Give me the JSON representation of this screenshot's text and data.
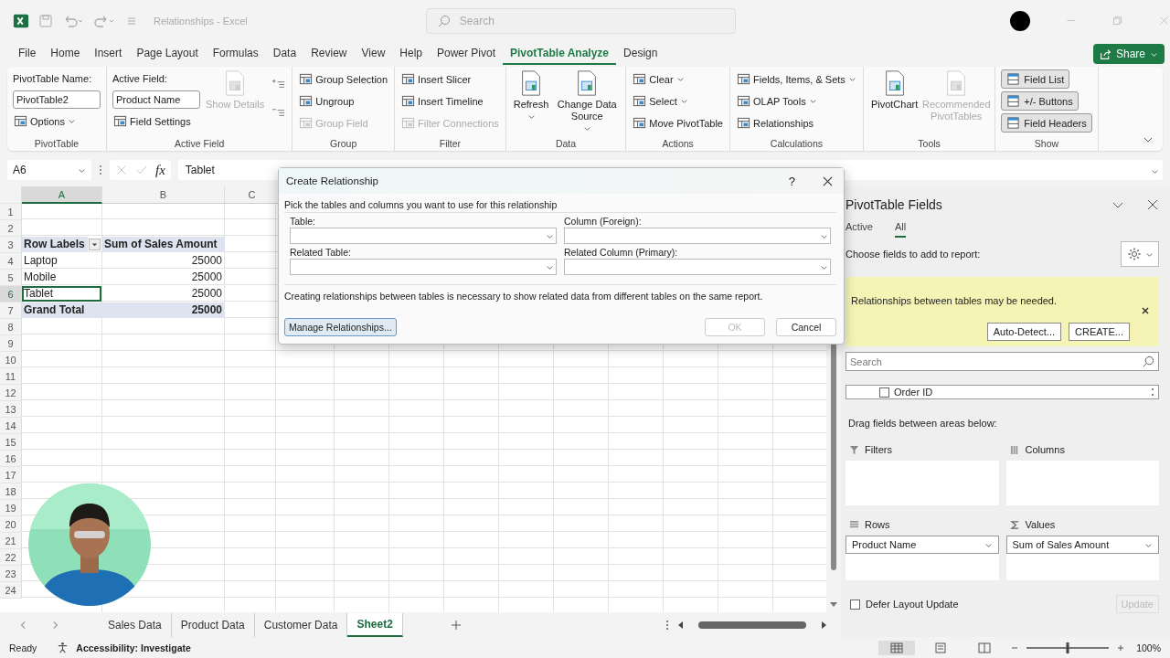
{
  "title_bar": {
    "title": "Relationships - Excel",
    "search_placeholder": "Search"
  },
  "menu_tabs": [
    {
      "label": "File",
      "selected": false
    },
    {
      "label": "Home",
      "selected": false
    },
    {
      "label": "Insert",
      "selected": false
    },
    {
      "label": "Page Layout",
      "selected": false
    },
    {
      "label": "Formulas",
      "selected": false
    },
    {
      "label": "Data",
      "selected": false
    },
    {
      "label": "Review",
      "selected": false
    },
    {
      "label": "View",
      "selected": false
    },
    {
      "label": "Help",
      "selected": false
    },
    {
      "label": "Power Pivot",
      "selected": false
    },
    {
      "label": "PivotTable Analyze",
      "selected": true
    },
    {
      "label": "Design",
      "selected": false
    }
  ],
  "share_button": "Share",
  "ribbon_groups": [
    {
      "name": "PivotTable",
      "columns": [
        [
          {
            "kind": "text",
            "text": "PivotTable Name:"
          },
          {
            "kind": "input",
            "value": "PivotTable2"
          },
          {
            "kind": "button",
            "label": "Options",
            "dropdown": true,
            "disabled": false
          }
        ]
      ]
    },
    {
      "name": "Active Field",
      "columns": [
        [
          {
            "kind": "text",
            "text": "Active Field:"
          },
          {
            "kind": "input",
            "value": "Product Name"
          },
          {
            "kind": "button",
            "label": "Field Settings",
            "dropdown": false,
            "disabled": false
          }
        ],
        [
          {
            "kind": "large",
            "label": "Show Details",
            "dropdown": false,
            "disabled": true
          }
        ],
        [
          {
            "kind": "expand_button"
          },
          {
            "kind": "collapse_button"
          }
        ]
      ]
    },
    {
      "name": "Group",
      "columns": [
        [
          {
            "kind": "button",
            "label": "Group Selection",
            "dropdown": false,
            "disabled": false
          },
          {
            "kind": "button",
            "label": "Ungroup",
            "dropdown": false,
            "disabled": false
          },
          {
            "kind": "button",
            "label": "Group Field",
            "dropdown": false,
            "disabled": true
          }
        ]
      ]
    },
    {
      "name": "Filter",
      "columns": [
        [
          {
            "kind": "button",
            "label": "Insert Slicer",
            "dropdown": false,
            "disabled": false
          },
          {
            "kind": "button",
            "label": "Insert Timeline",
            "dropdown": false,
            "disabled": false
          },
          {
            "kind": "button",
            "label": "Filter Connections",
            "dropdown": false,
            "disabled": true
          }
        ]
      ]
    },
    {
      "name": "Data",
      "columns": [
        [
          {
            "kind": "large",
            "label": "Refresh",
            "dropdown": true,
            "disabled": false
          }
        ],
        [
          {
            "kind": "large",
            "label": "Change Data Source",
            "dropdown": true,
            "disabled": false
          }
        ]
      ]
    },
    {
      "name": "Actions",
      "columns": [
        [
          {
            "kind": "button",
            "label": "Clear",
            "dropdown": true,
            "disabled": false
          },
          {
            "kind": "button",
            "label": "Select",
            "dropdown": true,
            "disabled": false
          },
          {
            "kind": "button",
            "label": "Move PivotTable",
            "dropdown": false,
            "disabled": false
          }
        ]
      ]
    },
    {
      "name": "Calculations",
      "columns": [
        [
          {
            "kind": "button",
            "label": "Fields, Items, & Sets",
            "dropdown": true,
            "disabled": false
          },
          {
            "kind": "button",
            "label": "OLAP Tools",
            "dropdown": true,
            "disabled": false
          },
          {
            "kind": "button",
            "label": "Relationships",
            "dropdown": false,
            "disabled": false
          }
        ]
      ]
    },
    {
      "name": "Tools",
      "columns": [
        [
          {
            "kind": "large",
            "label": "PivotChart",
            "dropdown": false,
            "disabled": false
          }
        ],
        [
          {
            "kind": "large",
            "label": "Recommended PivotTables",
            "dropdown": false,
            "disabled": true
          }
        ]
      ]
    },
    {
      "name": "Show",
      "columns": [
        [
          {
            "kind": "toggle",
            "label": "Field List",
            "selected": true
          },
          {
            "kind": "toggle",
            "label": "+/- Buttons",
            "selected": true
          },
          {
            "kind": "toggle",
            "label": "Field Headers",
            "selected": true
          }
        ]
      ]
    }
  ],
  "formula_bar": {
    "name_box": "A6",
    "function_label": "fx",
    "formula": "Tablet"
  },
  "sheet": {
    "columns": [
      {
        "label": "A",
        "selected": true
      },
      {
        "label": "B",
        "selected": false
      },
      {
        "label": "C",
        "selected": false
      }
    ],
    "rows": [
      {
        "number": "1",
        "kind": "empty",
        "selected": false
      },
      {
        "number": "2",
        "kind": "empty",
        "selected": false
      },
      {
        "number": "3",
        "kind": "header",
        "a": "Row Labels",
        "b": "Sum of Sales Amount",
        "selected": false
      },
      {
        "number": "4",
        "kind": "item",
        "a": "Laptop",
        "b": "25000",
        "selected": false
      },
      {
        "number": "5",
        "kind": "item",
        "a": "Mobile",
        "b": "25000",
        "selected": false
      },
      {
        "number": "6",
        "kind": "item",
        "a": "Tablet",
        "b": "25000",
        "selected": true
      },
      {
        "number": "7",
        "kind": "total",
        "a": "Grand Total",
        "b": "25000",
        "selected": false
      },
      {
        "number": "8",
        "kind": "empty",
        "selected": false
      },
      {
        "number": "9",
        "kind": "empty",
        "selected": false
      },
      {
        "number": "10",
        "kind": "empty",
        "selected": false
      },
      {
        "number": "11",
        "kind": "empty",
        "selected": false
      },
      {
        "number": "12",
        "kind": "empty",
        "selected": false
      },
      {
        "number": "13",
        "kind": "empty",
        "selected": false
      },
      {
        "number": "14",
        "kind": "empty",
        "selected": false
      },
      {
        "number": "15",
        "kind": "empty",
        "selected": false
      },
      {
        "number": "16",
        "kind": "empty",
        "selected": false
      },
      {
        "number": "17",
        "kind": "empty",
        "selected": false
      },
      {
        "number": "18",
        "kind": "empty",
        "selected": false
      },
      {
        "number": "19",
        "kind": "empty",
        "selected": false
      },
      {
        "number": "20",
        "kind": "empty",
        "selected": false
      },
      {
        "number": "21",
        "kind": "empty",
        "selected": false
      },
      {
        "number": "22",
        "kind": "empty",
        "selected": false
      },
      {
        "number": "23",
        "kind": "empty",
        "selected": false
      },
      {
        "number": "24",
        "kind": "empty",
        "selected": false
      }
    ]
  },
  "dialog": {
    "title": "Create Relationship",
    "help": "?",
    "instruction": "Pick the tables and columns you want to use for this relationship",
    "fields": [
      {
        "label": "Table:"
      },
      {
        "label": "Column (Foreign):"
      },
      {
        "label": "Related Table:"
      },
      {
        "label": "Related Column (Primary):"
      }
    ],
    "note": "Creating relationships between tables is necessary to show related data from different tables on the same report.",
    "manage_button": "Manage Relationships...",
    "buttons": [
      {
        "label": "OK",
        "disabled": true
      },
      {
        "label": "Cancel",
        "disabled": false
      }
    ]
  },
  "field_pane": {
    "title": "PivotTable Fields",
    "tabs": [
      {
        "label": "Active",
        "selected": false
      },
      {
        "label": "All",
        "selected": true
      }
    ],
    "choose_label": "Choose fields to add to report:",
    "notice": {
      "text": "Relationships between tables may be needed.",
      "buttons": [
        "Auto-Detect...",
        "CREATE..."
      ]
    },
    "search_placeholder": "Search",
    "fields": [
      {
        "label": "Order ID",
        "checked": false
      }
    ],
    "drag_label": "Drag fields between areas below:",
    "areas": [
      {
        "kind": "filters",
        "label": "Filters"
      },
      {
        "kind": "columns",
        "label": "Columns"
      },
      {
        "kind": "rows",
        "label": "Rows",
        "items": [
          "Product Name"
        ]
      },
      {
        "kind": "values",
        "label": "Values",
        "items": [
          "Sum of Sales Amount"
        ]
      }
    ],
    "defer": {
      "label": "Defer Layout Update",
      "checked": false
    },
    "update_button": {
      "label": "Update",
      "disabled": true
    }
  },
  "sheet_tabs": [
    {
      "label": "Sales Data",
      "selected": false
    },
    {
      "label": "Product Data",
      "selected": false
    },
    {
      "label": "Customer Data",
      "selected": false
    },
    {
      "label": "Sheet2",
      "selected": true
    }
  ],
  "status_bar": {
    "status": "Ready",
    "accessibility": "Accessibility: Investigate",
    "zoom": "100%",
    "zoom_slider": {
      "level": 0.5
    }
  }
}
